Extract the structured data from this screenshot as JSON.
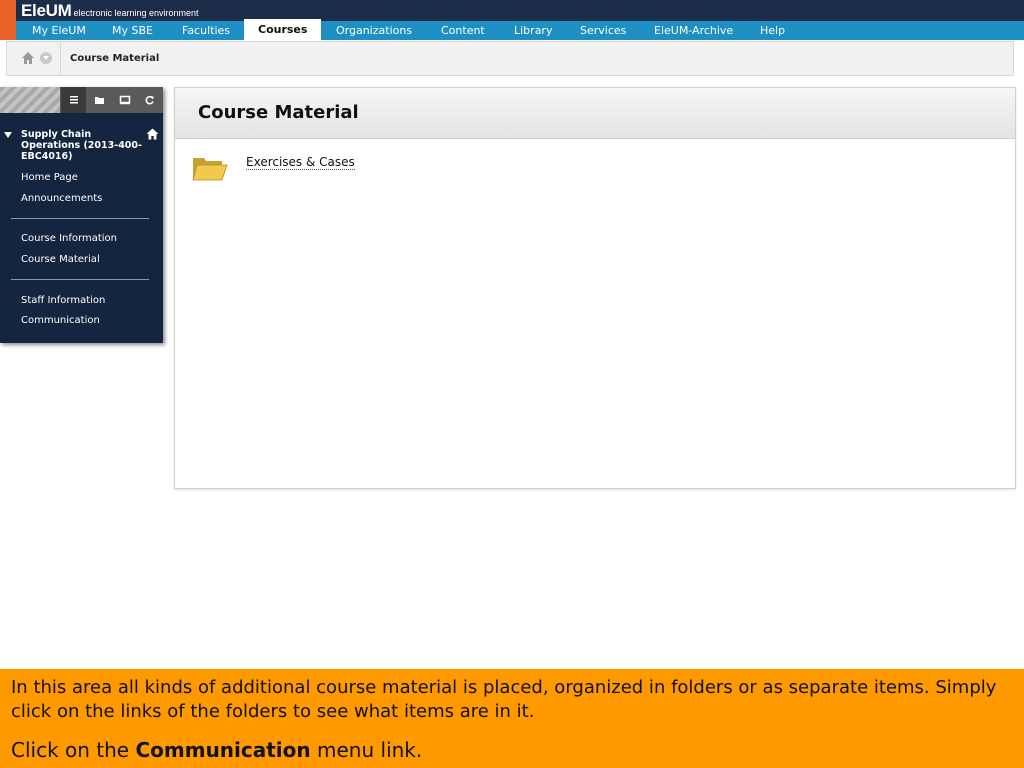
{
  "brand": {
    "name": "EleUM",
    "tagline": "electronic learning environment"
  },
  "nav_tabs": [
    {
      "label": "My EleUM"
    },
    {
      "label": "My SBE"
    },
    {
      "label": "Faculties"
    },
    {
      "label": "Courses",
      "active": true
    },
    {
      "label": "Organizations"
    },
    {
      "label": "Content"
    },
    {
      "label": "Library"
    },
    {
      "label": "Services"
    },
    {
      "label": "EleUM-Archive"
    },
    {
      "label": "Help"
    }
  ],
  "breadcrumb": {
    "current": "Course Material"
  },
  "course_menu": {
    "toolbar_icons": [
      "list-view-icon",
      "folder-view-icon",
      "window-icon",
      "refresh-icon"
    ],
    "course_title": "Supply Chain Operations (2013-400-EBC4016)",
    "links": [
      {
        "label": "Home Page"
      },
      {
        "label": "Announcements"
      },
      {
        "label": "Course Information"
      },
      {
        "label": "Course Material"
      },
      {
        "label": "Staff Information"
      },
      {
        "label": "Communication"
      }
    ]
  },
  "content": {
    "title": "Course Material",
    "items": [
      {
        "label": "Exercises & Cases",
        "icon": "folder-icon"
      }
    ]
  },
  "instruction": {
    "text": "In this area all kinds of additional course material is placed, organized in folders or as separate items. Simply click on the links of the folders to see what items are in it.",
    "prompt_prefix": "Click on the ",
    "prompt_bold": "Communication",
    "prompt_suffix": " menu link."
  },
  "colors": {
    "header_dark": "#1b2d49",
    "tab_bar": "#1d8fc3",
    "accent_orange": "#e8622a",
    "menu_bg": "#142540",
    "instruction_bg": "#ff9900"
  }
}
